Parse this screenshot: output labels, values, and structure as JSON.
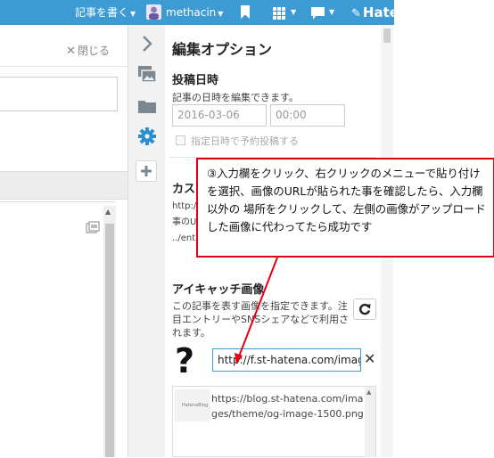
{
  "topbar": {
    "write_label": "記事を書く",
    "username": "methacin",
    "logo_text": "Hate",
    "bg_color": "#3d9bd4"
  },
  "left": {
    "close_label": "閉じる"
  },
  "icons": [
    "chevron-right-icon",
    "image-icon",
    "folder-icon",
    "gear-icon",
    "plus-icon"
  ],
  "panel": {
    "title": "編集オプション",
    "post_date": {
      "heading": "投稿日時",
      "description": "記事の日時を編集できます。",
      "date_value": "2016-03-06",
      "time_value": "00:00",
      "schedule_label": "指定日時で予約投稿する"
    },
    "custom_url": {
      "heading": "カス",
      "line1": "http:/",
      "line2": "事のU",
      "line3": "../entr"
    },
    "eyecatch": {
      "heading": "アイキャッチ画像",
      "description": "この記事を表す画像を指定できます。注目エントリーやSNSシェアなどで利用されます。",
      "placeholder_glyph": "?",
      "url_value": "http://f.st-hatena.com/images",
      "image_url": "https://blog.st-hatena.com/images/theme/og-image-1500.png",
      "thumb_label": "HatenaBlog"
    }
  },
  "callout": {
    "text": "③入力欄をクリック、右クリックのメニューで貼り付けを選択、画像のURLが貼られた事を確認したら、入力欄以外の 場所をクリックして、左側の画像がアップロードした画像に代わってたら成功です",
    "border_color": "#e60012"
  }
}
